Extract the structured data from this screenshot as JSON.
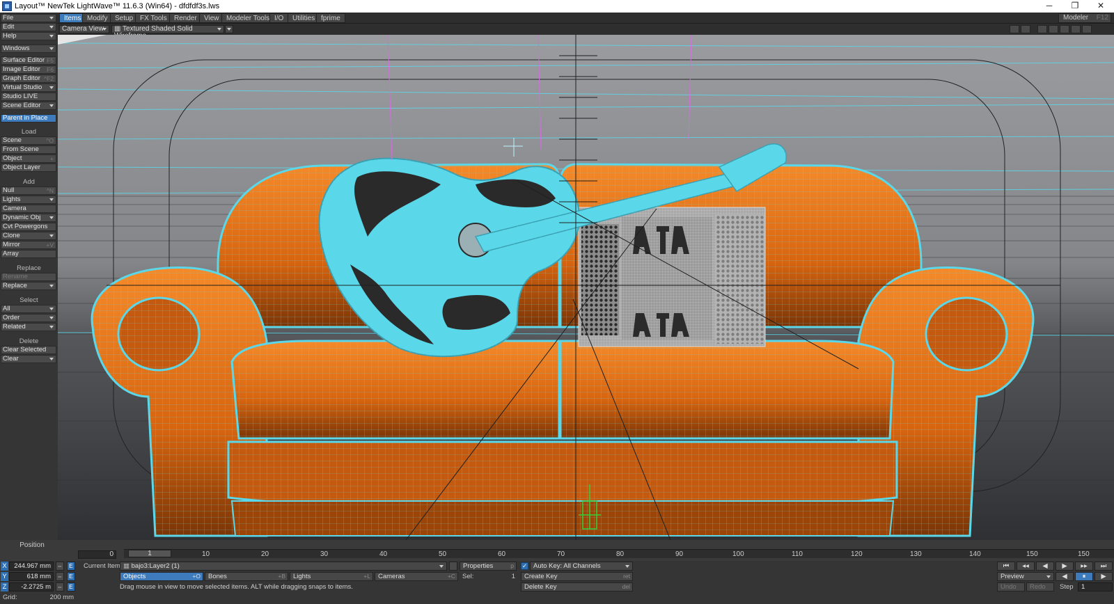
{
  "window": {
    "title": "Layout™ NewTek LightWave™ 11.6.3 (Win64) - dfdfdf3s.lws",
    "minimize": "─",
    "restore": "❐",
    "close": "✕"
  },
  "tabs": [
    {
      "label": "Items",
      "active": true
    },
    {
      "label": "Modify"
    },
    {
      "label": "Setup"
    },
    {
      "label": "FX Tools"
    },
    {
      "label": "Render"
    },
    {
      "label": "View"
    },
    {
      "label": "Modeler Tools"
    },
    {
      "label": "I/O"
    },
    {
      "label": "Utilities"
    },
    {
      "label": "fprime"
    }
  ],
  "modeler": {
    "label": "Modeler",
    "shortcut": "F12"
  },
  "sidebar": {
    "file": "File",
    "edit": "Edit",
    "help": "Help",
    "windows": "Windows",
    "surface_editor": "Surface Editor",
    "surface_editor_sc": "F5",
    "image_editor": "Image Editor",
    "image_editor_sc": "F6",
    "graph_editor": "Graph Editor",
    "graph_editor_sc": "^F2",
    "virtual_studio": "Virtual Studio",
    "studio_live": "Studio LIVE",
    "scene_editor": "Scene Editor",
    "parent_in_place": "Parent in Place",
    "load_header": "Load",
    "scene": "Scene",
    "scene_sc": "^O",
    "from_scene": "From Scene",
    "object": "Object",
    "object_sc": "+",
    "object_layer": "Object Layer",
    "add_header": "Add",
    "null": "Null",
    "null_sc": "^N",
    "lights": "Lights",
    "camera": "Camera",
    "dynamic_obj": "Dynamic Obj",
    "cvt_powergons": "Cvt Powergons",
    "clone": "Clone",
    "mirror": "Mirror",
    "mirror_sc": "+V",
    "array": "Array",
    "replace_header": "Replace",
    "rename": "Rename",
    "replace": "Replace",
    "select_header": "Select",
    "all": "All",
    "order": "Order",
    "related": "Related",
    "delete_header": "Delete",
    "clear_selected": "Clear Selected",
    "clear": "Clear"
  },
  "viewport": {
    "view_mode": "Camera View",
    "shading_mode": "Textured Shaded Solid Wireframe",
    "background_color": "#7f8185",
    "sofa_color": "#f07a1c",
    "wire_color": "#5ad8ea",
    "guitar_dark": "#2a2a2a",
    "accordion_color": "#a9a9a9"
  },
  "timeline": {
    "position_label": "Position",
    "start_frame": "0",
    "current_frame": "1",
    "ticks": [
      "10",
      "20",
      "30",
      "40",
      "50",
      "60",
      "70",
      "80",
      "90",
      "100",
      "110",
      "120",
      "130",
      "140",
      "150"
    ],
    "end_frame": "150"
  },
  "controls": {
    "x_label": "X",
    "x_value": "244.967 mm",
    "y_label": "Y",
    "y_value": "618 mm",
    "z_label": "Z",
    "z_value": "-2.2725 m",
    "grid_label": "Grid:",
    "grid_value": "200 mm",
    "e_label": "E",
    "arrows": "⇔",
    "current_item_label": "Current Item",
    "current_item_value": "bajo3:Layer2 (1)",
    "properties": "Properties",
    "properties_sc": "p",
    "auto_key": "Auto Key: All Channels",
    "objects": "Objects",
    "objects_sc": "+O",
    "bones": "Bones",
    "bones_sc": "+B",
    "lights": "Lights",
    "lights_sc": "+L",
    "cameras": "Cameras",
    "cameras_sc": "+C",
    "sel_label": "Sel:",
    "sel_value": "1",
    "create_key": "Create Key",
    "create_key_sc": "ret",
    "delete_key": "Delete Key",
    "delete_key_sc": "del",
    "status": "Drag mouse in view to move selected items. ALT while dragging snaps to items.",
    "preview": "Preview",
    "undo": "Undo",
    "redo": "Redo",
    "step_label": "Step",
    "step_value": "1",
    "transport_first": "⏮",
    "transport_prev_key": "◂◂",
    "transport_prev": "◀",
    "transport_pause": "⏸",
    "transport_next": "▶",
    "transport_next_key": "▸▸",
    "transport_last": "⏭",
    "transport_rev": "◀",
    "transport_play": "▶",
    "check": "✓"
  }
}
